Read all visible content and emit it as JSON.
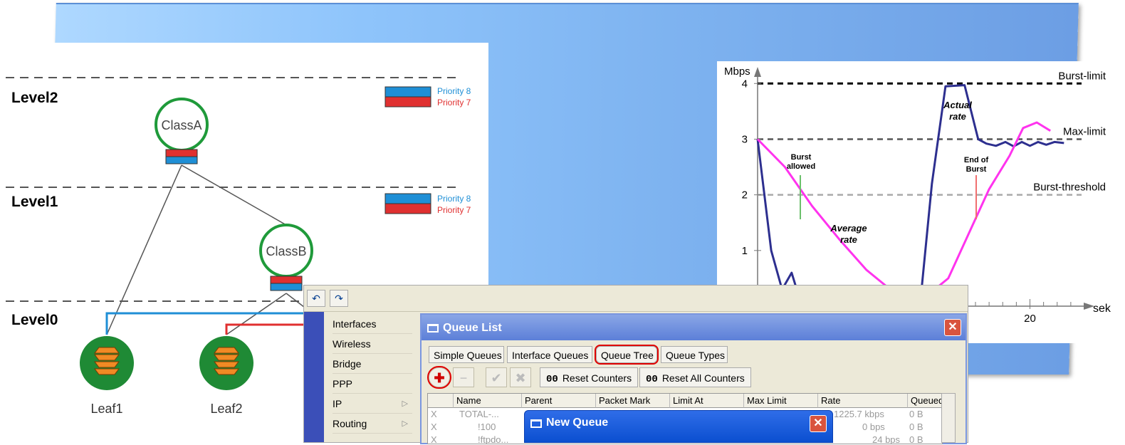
{
  "htb": {
    "levels": [
      "Level2",
      "Level1",
      "Level0"
    ],
    "nodes": [
      "ClassA",
      "ClassB",
      "Leaf1",
      "Leaf2"
    ],
    "legend": {
      "priority8": "Priority 8",
      "priority7": "Priority 7"
    },
    "colors": {
      "blue": "#1f8fd6",
      "red": "#e03030",
      "green": "#1f9a3a",
      "orange": "#f08a24"
    }
  },
  "chart_data": {
    "type": "line",
    "xlabel": "sek",
    "ylabel": "Mbps",
    "yticks": [
      1,
      2,
      3,
      4
    ],
    "xticks": [
      20
    ],
    "ylim": [
      0,
      4.4
    ],
    "xlim": [
      0,
      24
    ],
    "reference_lines": [
      {
        "name": "Burst-limit",
        "y": 4,
        "style": "dashed",
        "color": "#000000"
      },
      {
        "name": "Max-limit",
        "y": 3,
        "style": "dashed",
        "color": "#555555"
      },
      {
        "name": "Burst-threshold",
        "y": 2,
        "style": "dashed",
        "color": "#aaaaaa"
      }
    ],
    "series": [
      {
        "name": "Actual rate",
        "color": "#2d2f8f",
        "x": [
          0,
          1,
          1.8,
          2.5,
          3,
          12,
          12.8,
          13.8,
          15.2,
          16.2,
          16.8,
          17.5,
          18.2,
          18.8,
          19.4,
          20,
          20.6,
          21.2,
          21.8,
          22.5
        ],
        "y": [
          3,
          1,
          0.3,
          0.6,
          0.2,
          0.2,
          2.2,
          3.95,
          3.97,
          3,
          2.92,
          2.88,
          2.95,
          2.87,
          2.95,
          2.88,
          2.95,
          2.9,
          2.95,
          2.93
        ]
      },
      {
        "name": "Average rate",
        "color": "#ff33ee",
        "x": [
          0,
          2,
          4,
          6,
          8,
          10,
          12,
          14,
          15.5,
          17,
          18.5,
          19.5,
          20.5,
          21.5
        ],
        "y": [
          3,
          2.5,
          1.8,
          1.2,
          0.65,
          0.25,
          0.1,
          0.5,
          1.3,
          2.1,
          2.7,
          3.2,
          3.3,
          3.15
        ]
      }
    ],
    "annotations": {
      "burst_allowed": "Burst allowed",
      "end_of_burst": "End of Burst",
      "actual_rate": "Actual rate",
      "average_rate": "Average rate"
    }
  },
  "winbox": {
    "toolbar": {
      "undo": "↶",
      "redo": "↷"
    },
    "menu": [
      {
        "label": "Interfaces",
        "arrow": false
      },
      {
        "label": "Wireless",
        "arrow": false
      },
      {
        "label": "Bridge",
        "arrow": false
      },
      {
        "label": "PPP",
        "arrow": false
      },
      {
        "label": "IP",
        "arrow": true
      },
      {
        "label": "Routing",
        "arrow": true
      }
    ],
    "arrow_glyph": "▷",
    "queue_list": {
      "title": "Queue List",
      "close": "✕",
      "tabs": [
        "Simple Queues",
        "Interface Queues",
        "Queue Tree",
        "Queue Types"
      ],
      "active_tab": "Queue Tree",
      "buttons": {
        "add": "✚",
        "remove": "−",
        "enable": "✔",
        "disable": "✖",
        "reset_counters": "Reset Counters",
        "reset_all_counters": "Reset All Counters",
        "oo": "00"
      },
      "columns": [
        "Name",
        "Parent",
        "Packet Mark",
        "Limit At",
        "Max Limit",
        "Rate",
        "Queued"
      ],
      "rows": [
        {
          "x": "X",
          "name": "TOTAL-...",
          "rate": "1225.7 kbps",
          "queued": "0 B"
        },
        {
          "x": "X",
          "name": "!100",
          "rate": "0 bps",
          "queued": "0 B"
        },
        {
          "x": "X",
          "name": "!ftpdo...",
          "rate": "24 bps",
          "queued": "0 B"
        }
      ]
    },
    "new_queue": {
      "title": "New Queue",
      "close": "✕"
    }
  }
}
